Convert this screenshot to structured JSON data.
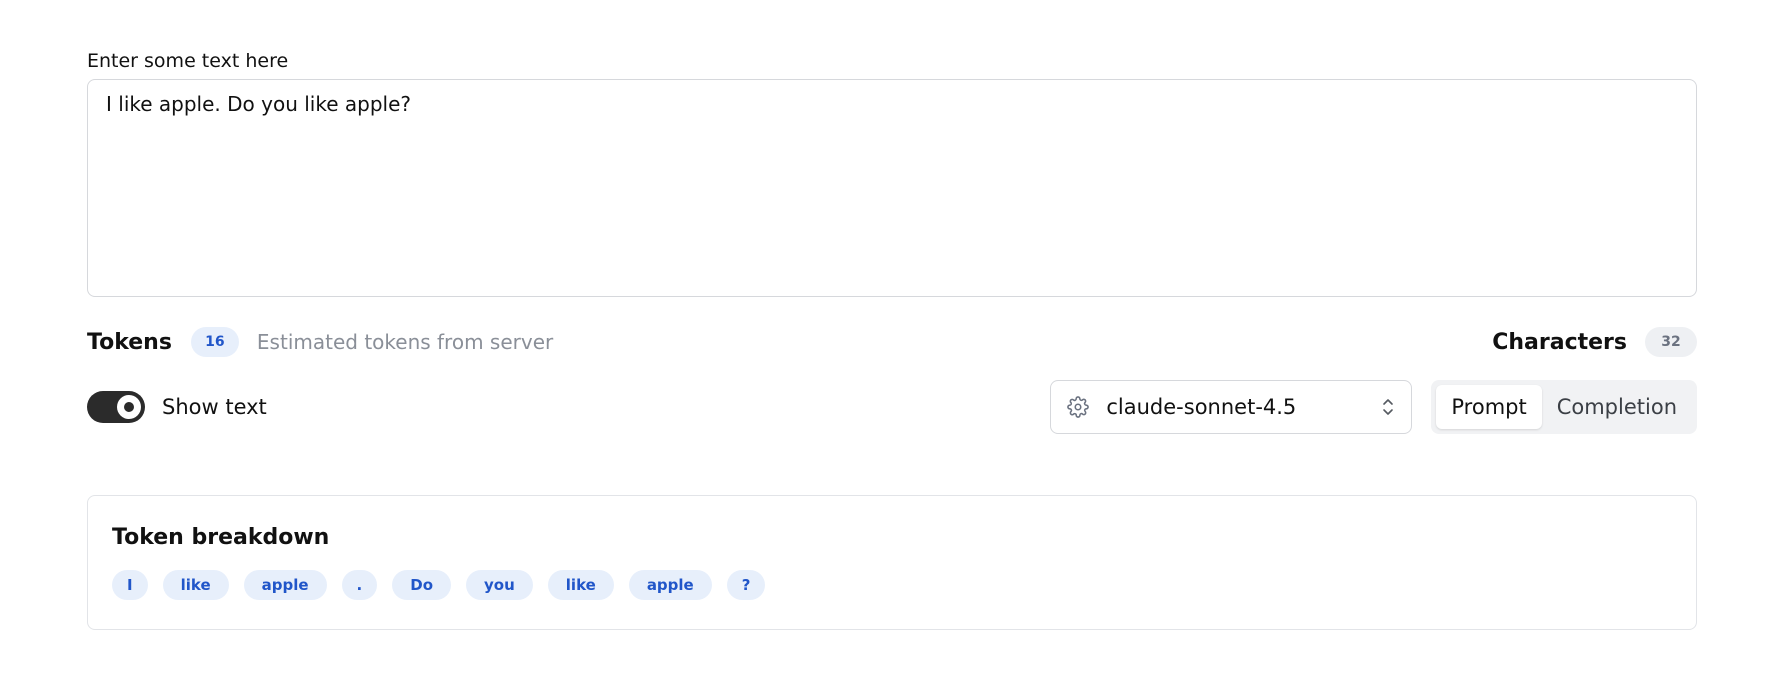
{
  "input": {
    "label": "Enter some text here",
    "value": "I like apple. Do you like apple?"
  },
  "stats": {
    "tokens_label": "Tokens",
    "tokens_count": "16",
    "estimated_text": "Estimated tokens from server",
    "characters_label": "Characters",
    "characters_count": "32"
  },
  "controls": {
    "show_text_label": "Show text",
    "show_text_enabled": true,
    "model": "claude-sonnet-4.5",
    "model_icon": "gear-icon",
    "select_icon": "chevron-up-down-icon",
    "modes": [
      {
        "label": "Prompt",
        "active": true
      },
      {
        "label": "Completion",
        "active": false
      }
    ]
  },
  "breakdown": {
    "title": "Token breakdown",
    "tokens": [
      "I",
      "like",
      "apple",
      ".",
      "Do",
      "you",
      "like",
      "apple",
      "?"
    ]
  },
  "colors": {
    "accent_text": "#2156c9",
    "chip_background": "#e7effb",
    "toggle_on": "#2b2b2b"
  }
}
